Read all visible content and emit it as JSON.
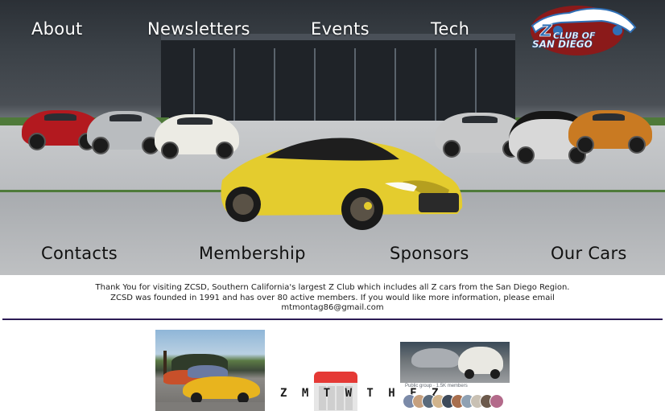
{
  "nav": {
    "about": "About",
    "newsletters": "Newsletters",
    "events": "Events",
    "tech": "Tech",
    "contacts": "Contacts",
    "membership": "Membership",
    "sponsors": "Sponsors",
    "our_cars": "Our Cars"
  },
  "logo": {
    "letter": "Z",
    "line1": "CLUB OF",
    "line2": "SAN DIEGO",
    "colors": {
      "oval": "#8b1a1a",
      "car": "#2f6fb5",
      "text": "#ffffff"
    }
  },
  "intro": {
    "line1": "Thank You for visiting ZCSD, Southern California's largest Z Club which includes all Z cars from the San Diego Region.",
    "line2": "ZCSD was founded in 1991 and has over 80 active members. If you would like more information, please email",
    "email": "mtmontag86@gmail.com"
  },
  "widgets": {
    "calendar_days": "Z M T W T H F Z",
    "facebook_group_meta": "Public group · 1.5K members"
  },
  "colors": {
    "divider": "#2c1b55",
    "calendar_red": "#e53935"
  }
}
